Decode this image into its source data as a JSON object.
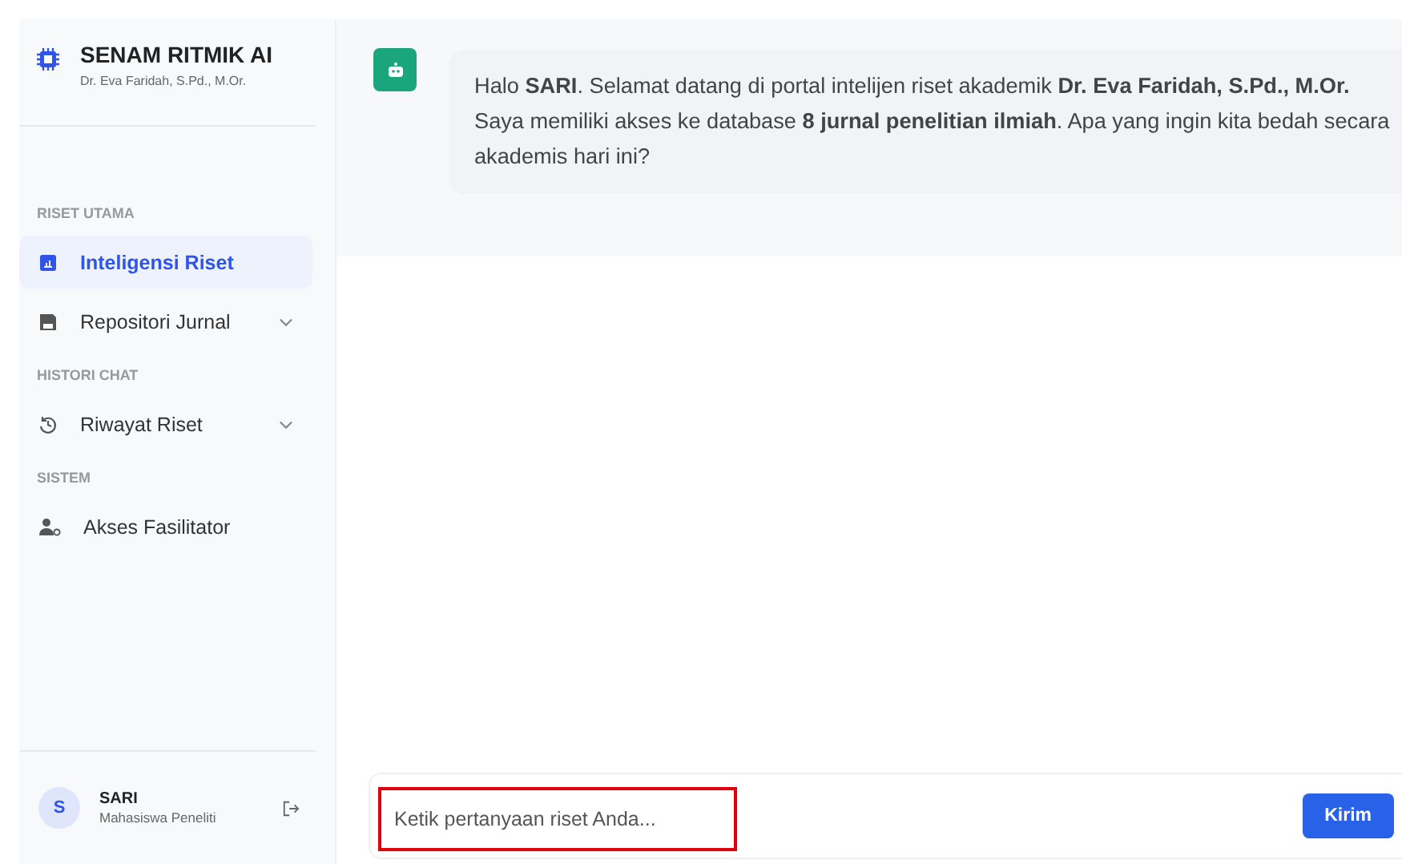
{
  "brand": {
    "title": "SENAM RITMIK AI",
    "subtitle": "Dr. Eva Faridah, S.Pd., M.Or."
  },
  "nav_sections": [
    {
      "heading": "RISET UTAMA",
      "items": [
        {
          "label": "Inteligensi Riset",
          "kind": "chart",
          "selected": true,
          "expandable": false
        },
        {
          "label": "Repositori Jurnal",
          "kind": "save",
          "selected": false,
          "expandable": true
        }
      ]
    },
    {
      "heading": "HISTORI CHAT",
      "items": [
        {
          "label": "Riwayat Riset",
          "kind": "history",
          "selected": false,
          "expandable": true
        }
      ]
    },
    {
      "heading": "SISTEM",
      "items": [
        {
          "label": "Akses Fasilitator",
          "kind": "user",
          "selected": false,
          "expandable": false
        }
      ]
    }
  ],
  "user": {
    "initial": "S",
    "name": "SARI",
    "role": "Mahasiswa Peneliti"
  },
  "message": {
    "text": "Halo **SARI**. Selamat datang di portal intelijen riset akademik **Dr. Eva Faridah, S.Pd., M.Or.** Saya memiliki akses ke database **8 jurnal penelitian ilmiah**. Apa yang ingin kita bedah secara akademis hari ini?"
  },
  "composer": {
    "placeholder": "Ketik pertanyaan riset Anda...",
    "highlighted": true,
    "send": "Kirim"
  }
}
